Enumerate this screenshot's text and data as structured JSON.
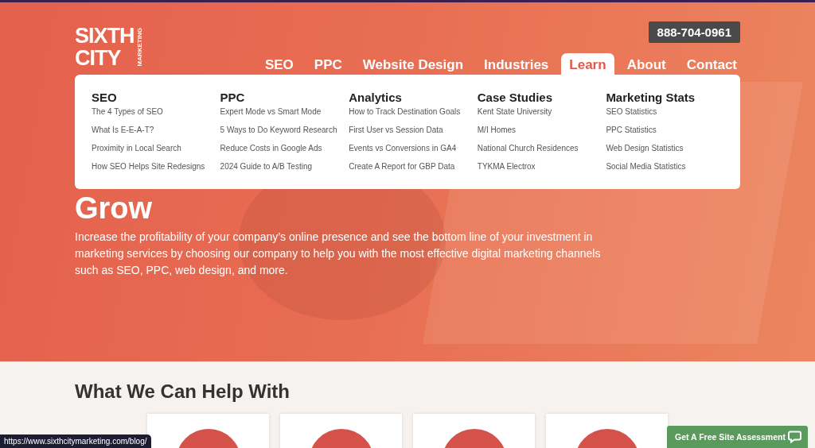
{
  "logo": {
    "line_1": "SIXTH",
    "line_2": "CITY",
    "tagline": "MARKETING"
  },
  "phone": "888-704-0961",
  "nav": [
    {
      "label": "SEO",
      "selected": false
    },
    {
      "label": "PPC",
      "selected": false
    },
    {
      "label": "Website Design",
      "selected": false
    },
    {
      "label": "Industries",
      "selected": false
    },
    {
      "label": "Learn",
      "selected": true
    },
    {
      "label": "About",
      "selected": false
    },
    {
      "label": "Contact",
      "selected": false
    }
  ],
  "mega_menu": {
    "columns": [
      {
        "heading": "SEO",
        "links": [
          "The 4 Types of SEO",
          "What Is E-E-A-T?",
          "Proximity in Local Search",
          "How SEO Helps Site Redesigns"
        ]
      },
      {
        "heading": "PPC",
        "links": [
          "Expert Mode vs Smart Mode",
          "5 Ways to Do Keyword Research",
          "Reduce Costs in Google Ads",
          "2024 Guide to A/B Testing"
        ]
      },
      {
        "heading": "Analytics",
        "links": [
          "How to Track Destination Goals",
          "First User vs Session Data",
          "Events vs Conversions in GA4",
          "Create A Report for GBP Data"
        ]
      },
      {
        "heading": "Case Studies",
        "links": [
          "Kent State University",
          "M/I Homes",
          "National Church Residences",
          "TYKMA Electrox"
        ]
      },
      {
        "heading": "Marketing Stats",
        "links": [
          "SEO Statistics",
          "PPC Statistics",
          "Web Design Statistics",
          "Social Media Statistics"
        ]
      }
    ]
  },
  "hero": {
    "heading": "Grow",
    "text": "Increase the profitability of your company’s online presence and see the bottom line of your investment in marketing services by choosing our company to help you with the most effective digital marketing channels such as SEO, PPC, web design, and more."
  },
  "services": {
    "heading": "What We Can Help With"
  },
  "status_url": "https://www.sixthcitymarketing.com/blog/",
  "chat_button": "Get A Free Site Assessment"
}
